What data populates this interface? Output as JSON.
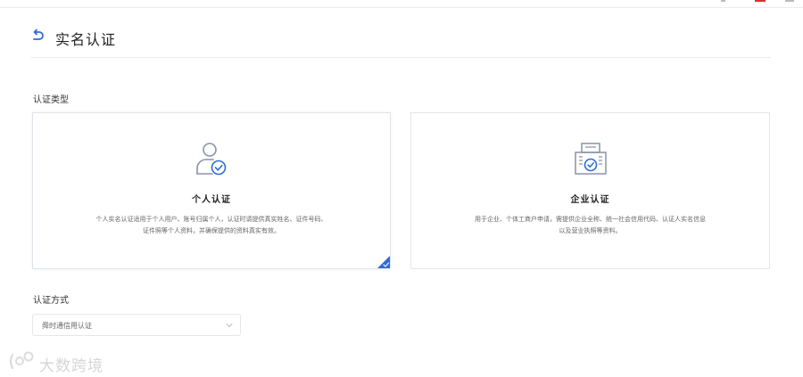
{
  "header": {
    "title": "实名认证",
    "back_icon": "back-arrow-icon"
  },
  "sections": {
    "type_label": "认证类型",
    "method_label": "认证方式"
  },
  "cards": {
    "personal": {
      "title": "个人认证",
      "description": "个人实名认证适用于个人用户、账号归属个人，认证时请提供真实姓名、证件号码、证件照等个人资料，并确保提供的资料真实有效。",
      "icon": "user-verified-icon",
      "selected": true
    },
    "enterprise": {
      "title": "企业认证",
      "description": "用于企业、个体工商户申请，需提供企业全称、统一社会信用代码、认证人实名信息以及营业执照等资料。",
      "icon": "building-verified-icon",
      "selected": false
    }
  },
  "method_select": {
    "value": "舜时通信用认证"
  },
  "watermark": {
    "text": "大数跨境"
  },
  "colors": {
    "accent": "#2f6bd8",
    "icon_gray": "#8a93a6",
    "border": "#e4e6eb"
  }
}
